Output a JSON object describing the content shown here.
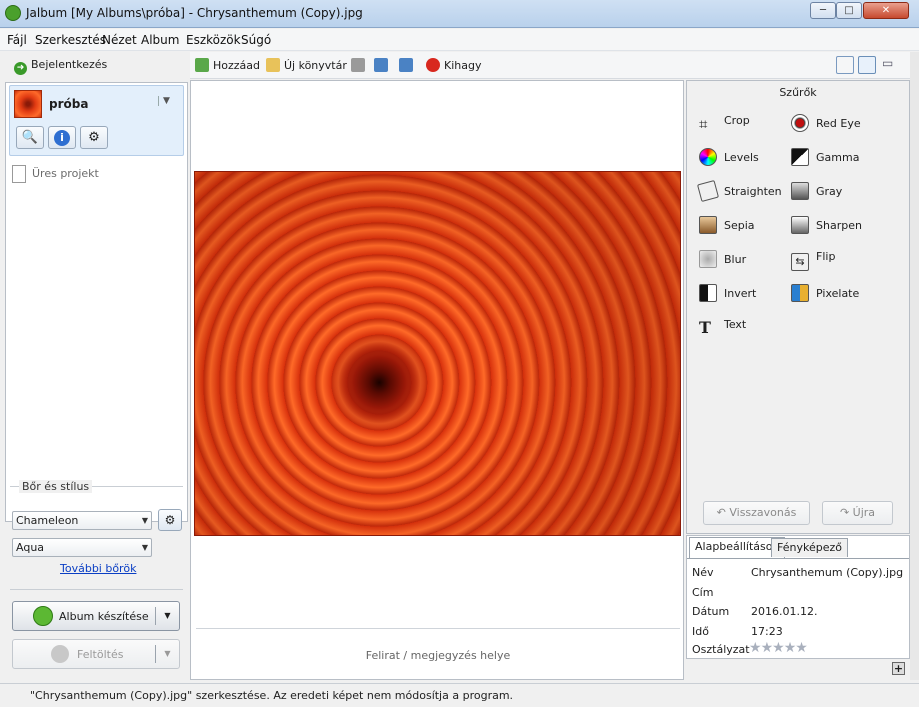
{
  "window": {
    "title": "Jalbum [My Albums\\próba] - Chrysanthemum (Copy).jpg",
    "minimize": "─",
    "maximize": "□",
    "close": "✕"
  },
  "menu": [
    "Fájl",
    "Szerkesztés",
    "Nézet",
    "Album",
    "Eszközök",
    "Súgó"
  ],
  "left": {
    "login": "Bejelentkezés",
    "project_name": "próba",
    "empty_project": "Üres projekt",
    "skin_section": "Bőr és stílus",
    "skin_value": "Chameleon",
    "style_value": "Aqua",
    "more_skins": "További bőrök",
    "make_album": "Album készítése",
    "upload": "Feltöltés"
  },
  "toolbar": {
    "add": "Hozzáad",
    "new_folder": "Új könyvtár",
    "exclude": "Kihagy"
  },
  "center": {
    "caption_placeholder": "Felirat / megjegyzés helye"
  },
  "filters": {
    "title": "Szűrők",
    "items": [
      "Crop",
      "Red Eye",
      "Levels",
      "Gamma",
      "Straighten",
      "Gray",
      "Sepia",
      "Sharpen",
      "Blur",
      "Flip",
      "Invert",
      "Pixelate",
      "Text"
    ],
    "undo": "Visszavonás",
    "redo": "Újra"
  },
  "props": {
    "tabs": [
      "Alapbeállítások",
      "Fényképező"
    ],
    "name_label": "Név",
    "name_value": "Chrysanthemum (Copy).jpg",
    "title_label": "Cím",
    "date_label": "Dátum",
    "date_value": "2016.01.12.",
    "time_label": "Idő",
    "time_value": "17:23",
    "rating_label": "Osztályzat",
    "rating": 0
  },
  "status": "\"Chrysanthemum (Copy).jpg\" szerkesztése. Az eredeti képet nem módosítja a program."
}
